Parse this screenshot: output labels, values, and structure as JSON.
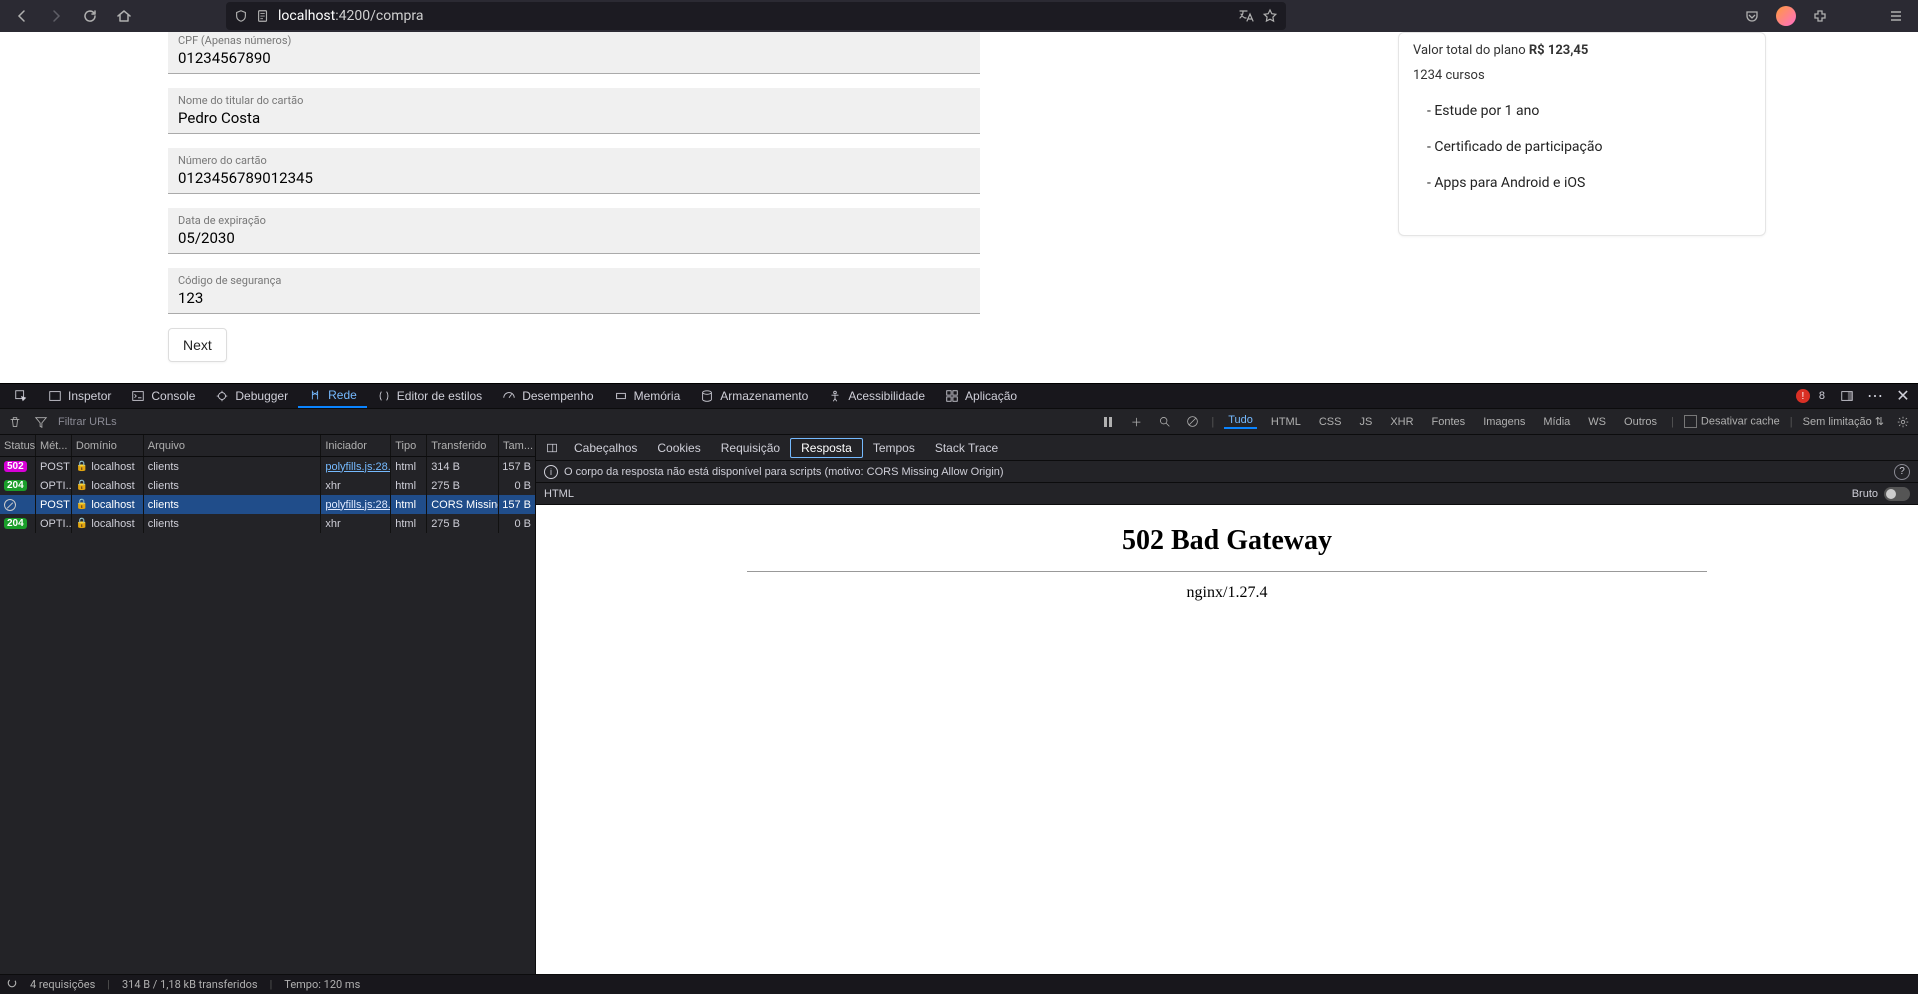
{
  "browser": {
    "url_host": "localhost",
    "url_port": ":4200",
    "url_path": "/compra"
  },
  "form": {
    "cpf": {
      "label": "CPF (Apenas números)",
      "value": "01234567890"
    },
    "holder": {
      "label": "Nome do titular do cartão",
      "value": "Pedro Costa"
    },
    "cardnum": {
      "label": "Número do cartão",
      "value": "0123456789012345"
    },
    "exp": {
      "label": "Data de expiração",
      "value": "05/2030"
    },
    "cvv": {
      "label": "Código de segurança",
      "value": "123"
    },
    "next": "Next"
  },
  "summary": {
    "total_label": "Valor total do plano",
    "total_value": "R$ 123,45",
    "courses": "1234 cursos",
    "features": [
      "- Estude por 1 ano",
      "- Certificado de participação",
      "- Apps para Android e iOS"
    ]
  },
  "devtools": {
    "tabs": [
      "Inspetor",
      "Console",
      "Debugger",
      "Rede",
      "Editor de estilos",
      "Desempenho",
      "Memória",
      "Armazenamento",
      "Acessibilidade",
      "Aplicação"
    ],
    "tabs_active": "Rede",
    "error_count": "8",
    "filter_placeholder": "Filtrar URLs",
    "type_filters": [
      "Tudo",
      "HTML",
      "CSS",
      "JS",
      "XHR",
      "Fontes",
      "Imagens",
      "Mídia",
      "WS",
      "Outros"
    ],
    "type_active": "Tudo",
    "disable_cache": "Desativar cache",
    "throttle": "Sem limitação",
    "columns": [
      "Status",
      "Mét...",
      "Domínio",
      "Arquivo",
      "Iniciador",
      "Tipo",
      "Transferido",
      "Tam..."
    ],
    "rows": [
      {
        "status": "502",
        "status_class": "b502",
        "method": "POST",
        "domain": "localhost",
        "file": "clients",
        "initiator": "polyfills.js:28...",
        "init_link": true,
        "type": "html",
        "transferred": "314 B",
        "size": "157 B"
      },
      {
        "status": "204",
        "status_class": "b204",
        "method": "OPTI...",
        "domain": "localhost",
        "file": "clients",
        "initiator": "xhr",
        "init_link": false,
        "type": "html",
        "transferred": "275 B",
        "size": "0 B"
      },
      {
        "status": "block",
        "status_class": "bblock",
        "method": "POST",
        "domain": "localhost",
        "file": "clients",
        "initiator": "polyfills.js:28...",
        "init_link": true,
        "type": "html",
        "transferred": "CORS Missing...",
        "size": "157 B",
        "selected": true
      },
      {
        "status": "204",
        "status_class": "b204",
        "method": "OPTI...",
        "domain": "localhost",
        "file": "clients",
        "initiator": "xhr",
        "init_link": false,
        "type": "html",
        "transferred": "275 B",
        "size": "0 B"
      }
    ],
    "footer": {
      "reqs": "4 requisições",
      "bytes": "314 B / 1,18 kB transferidos",
      "time": "Tempo: 120 ms"
    },
    "detail_tabs": [
      "Cabeçalhos",
      "Cookies",
      "Requisição",
      "Resposta",
      "Tempos",
      "Stack Trace"
    ],
    "detail_active": "Resposta",
    "warn": "O corpo da resposta não está disponível para scripts (motivo: CORS Missing Allow Origin)",
    "html_label": "HTML",
    "raw_label": "Bruto",
    "response_h1": "502 Bad Gateway",
    "response_sub": "nginx/1.27.4"
  }
}
